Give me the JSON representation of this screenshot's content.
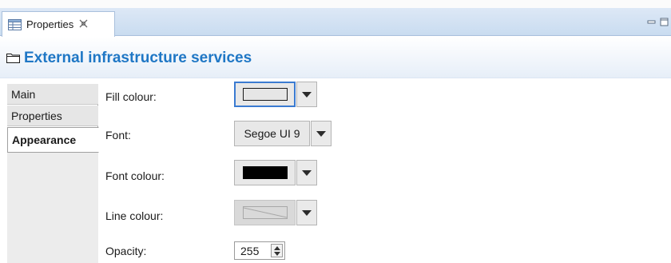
{
  "view_tab": {
    "title": "Properties",
    "icon": "properties-table-icon",
    "close_icon": "close-icon"
  },
  "window_controls": [
    "minimize-icon",
    "maximize-icon"
  ],
  "header": {
    "title": "External infrastructure services",
    "icon": "folder-icon"
  },
  "sidebar": {
    "items": [
      {
        "label": "Main",
        "active": false
      },
      {
        "label": "Properties",
        "active": false
      },
      {
        "label": "Appearance",
        "active": true
      }
    ]
  },
  "form": {
    "fill_colour": {
      "label": "Fill colour:",
      "swatch_color": "#e6e6e6"
    },
    "font": {
      "label": "Font:",
      "value": "Segoe UI 9"
    },
    "font_colour": {
      "label": "Font colour:",
      "swatch_color": "#000000"
    },
    "line_colour": {
      "label": "Line colour:",
      "state": "disabled"
    },
    "opacity": {
      "label": "Opacity:",
      "value": "255"
    }
  },
  "colors": {
    "accent": "#1f77c5",
    "tab_bar": "#c9dcf0",
    "focus_border": "#3b7bd1"
  }
}
